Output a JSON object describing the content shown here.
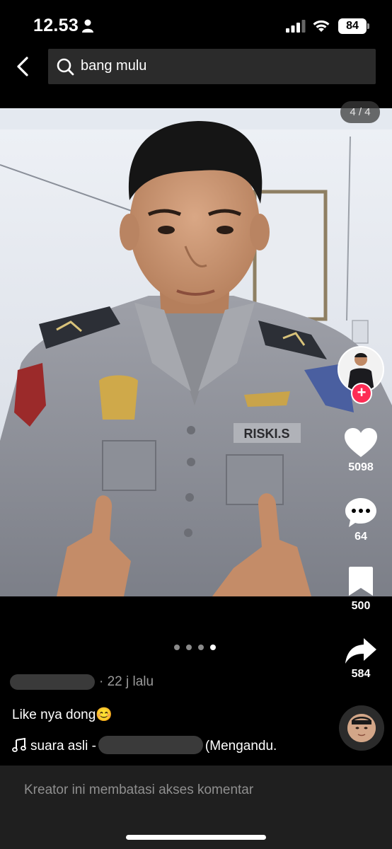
{
  "status_bar": {
    "time": "12.53",
    "battery": "84",
    "icons": [
      "person-icon",
      "signal-icon",
      "wifi-icon",
      "battery-icon"
    ]
  },
  "header": {
    "back_icon": "chevron-left-icon",
    "search_icon": "search-icon",
    "search_value": "bang mulu"
  },
  "post": {
    "page_counter": "4 / 4",
    "current_image": 4,
    "total_images": 4,
    "name_tag": "RISKI.S",
    "time_ago": "· 22 j lalu",
    "caption": "Like nya dong😊",
    "music_prefix": "suara asli -",
    "music_suffix": "(Mengandu."
  },
  "actions": {
    "likes": "5098",
    "comments": "64",
    "saves": "500",
    "shares": "584",
    "follow_symbol": "+"
  },
  "comments_bar": {
    "notice": "Kreator ini membatasi akses komentar"
  },
  "colors": {
    "background": "#000000",
    "accent": "#fe2c55",
    "comments_bar": "#1f1f1f",
    "search_bg": "#2b2b2b"
  }
}
